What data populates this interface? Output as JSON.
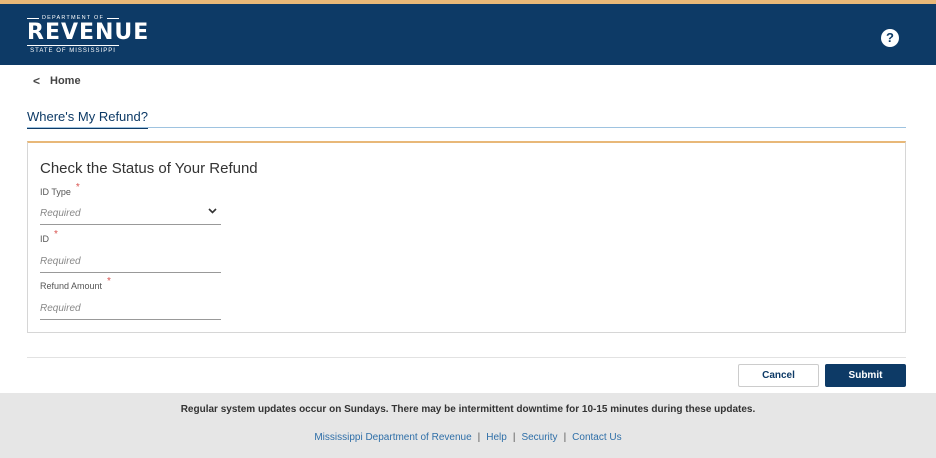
{
  "header": {
    "logo_top": "DEPARTMENT OF",
    "logo_main": "REVENUE",
    "logo_bottom": "STATE OF MISSISSIPPI",
    "help_icon": "?",
    "colors": {
      "navy": "#0d3a66",
      "accent": "#e8b878"
    }
  },
  "breadcrumb": {
    "chevron": "<",
    "home_label": "Home"
  },
  "page": {
    "title": "Where's My Refund?"
  },
  "form": {
    "title": "Check the Status of Your Refund",
    "required_marker": "*",
    "fields": [
      {
        "label": "ID Type",
        "placeholder": "Required",
        "type": "select",
        "icon": "chevron-down-icon"
      },
      {
        "label": "ID",
        "placeholder": "Required",
        "type": "text"
      },
      {
        "label": "Refund Amount",
        "placeholder": "Required",
        "type": "text"
      }
    ]
  },
  "actions": {
    "cancel_label": "Cancel",
    "submit_label": "Submit"
  },
  "footer": {
    "notice": "Regular system updates occur on Sundays. There may be intermittent downtime for 10-15 minutes during these updates.",
    "separator": "|",
    "links": [
      "Mississippi Department of Revenue",
      "Help",
      "Security",
      "Contact Us"
    ]
  }
}
